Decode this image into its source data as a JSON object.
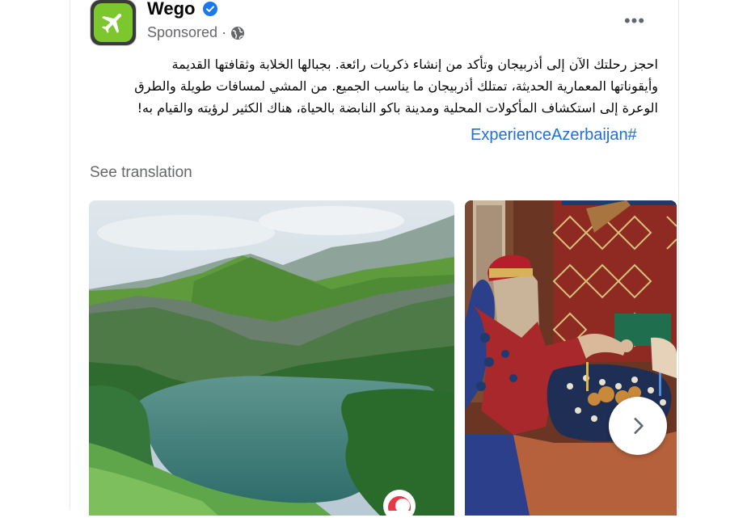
{
  "post": {
    "page_name": "Wego",
    "sponsored_label": "Sponsored",
    "separator": "·",
    "more_label": "•••",
    "body_lines": [
      "احجز رحلتك الآن إلى أذربيجان وتأكد من إنشاء ذكريات رائعة. بجبالها الخلابة وثقافتها القديمة",
      "وأيقوناتها المعمارية الحديثة، تمتلك أذربيجان ما يناسب الجميع. من المشي لمسافات طويلة والطرق",
      "الوعرة إلى استكشاف المأكولات المحلية ومدينة باكو النابضة بالحياة، هناك الكثير لرؤيته والقيام به!"
    ],
    "hashtag": "ExperienceAzerbaijan#",
    "see_translation": "See translation"
  },
  "icons": {
    "avatar": "airplane-icon",
    "verified": "verified-badge-icon",
    "audience": "globe-icon",
    "next": "chevron-right-icon"
  },
  "colors": {
    "brand_green": "#7cc62e",
    "verified_blue": "#1877f2",
    "link_blue": "#216fdb",
    "muted_text": "#65676b"
  }
}
